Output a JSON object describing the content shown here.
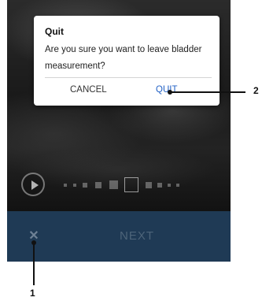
{
  "dialog": {
    "title": "Quit",
    "message": "Are you sure you want to leave bladder measurement?",
    "cancel_label": "CANCEL",
    "quit_label": "QUIT"
  },
  "bottom_bar": {
    "close_symbol": "✕",
    "next_label": "NEXT"
  },
  "player": {
    "play_icon": "play-icon"
  },
  "callouts": {
    "one": "1",
    "two": "2"
  },
  "colors": {
    "bottom_bar_bg": "#1f3a55",
    "quit_accent": "#2563c6"
  }
}
